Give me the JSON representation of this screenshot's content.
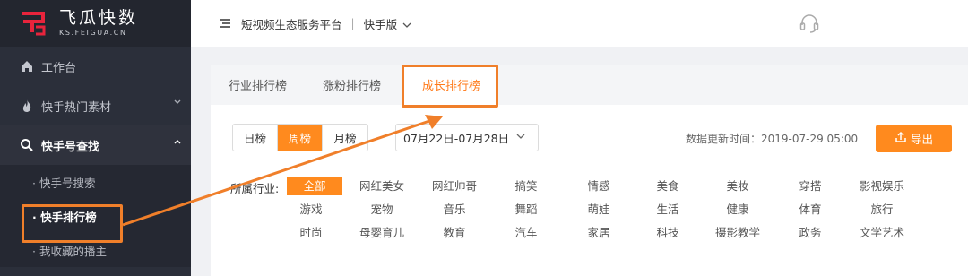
{
  "brand": {
    "name": "飞瓜快数",
    "domain": "KS.FEIGUA.CN",
    "accent": "#e8243c"
  },
  "sidebar": {
    "items": [
      {
        "label": "工作台",
        "icon": "home-icon"
      },
      {
        "label": "快手热门素材",
        "icon": "fire-icon",
        "chevron": "chevron-down-icon"
      },
      {
        "label": "快手号查找",
        "icon": "search-icon",
        "chevron": "chevron-up-icon"
      }
    ],
    "submenu": [
      {
        "label": "· 快手号搜索"
      },
      {
        "label": "· 快手排行榜"
      },
      {
        "label": "· 我收藏的播主"
      }
    ]
  },
  "header": {
    "platform": "短视频生态服务平台",
    "separator": "|",
    "version": "快手版",
    "support_icon": "headset-icon"
  },
  "tabs": [
    {
      "label": "行业排行榜"
    },
    {
      "label": "涨粉排行榜"
    },
    {
      "label": "成长排行榜"
    }
  ],
  "period": {
    "options": [
      "日榜",
      "周榜",
      "月榜"
    ],
    "selected": "周榜"
  },
  "date_range": "07月22日-07月28日",
  "updated": "数据更新时间：2019-07-29 05:00",
  "export_label": "导出",
  "category_label": "所属行业:",
  "categories": [
    [
      "全部",
      "网红美女",
      "网红帅哥",
      "搞笑",
      "情感",
      "美食",
      "美妆",
      "穿搭",
      "影视娱乐"
    ],
    [
      "游戏",
      "宠物",
      "音乐",
      "舞蹈",
      "萌娃",
      "生活",
      "健康",
      "体育",
      "旅行"
    ],
    [
      "时尚",
      "母婴育儿",
      "教育",
      "汽车",
      "家居",
      "科技",
      "摄影教学",
      "政务",
      "文学艺术"
    ]
  ],
  "colors": {
    "accent": "#ff8a1e",
    "annotation": "#f07f2a",
    "sidebar_bg": "#2b2f3a"
  }
}
